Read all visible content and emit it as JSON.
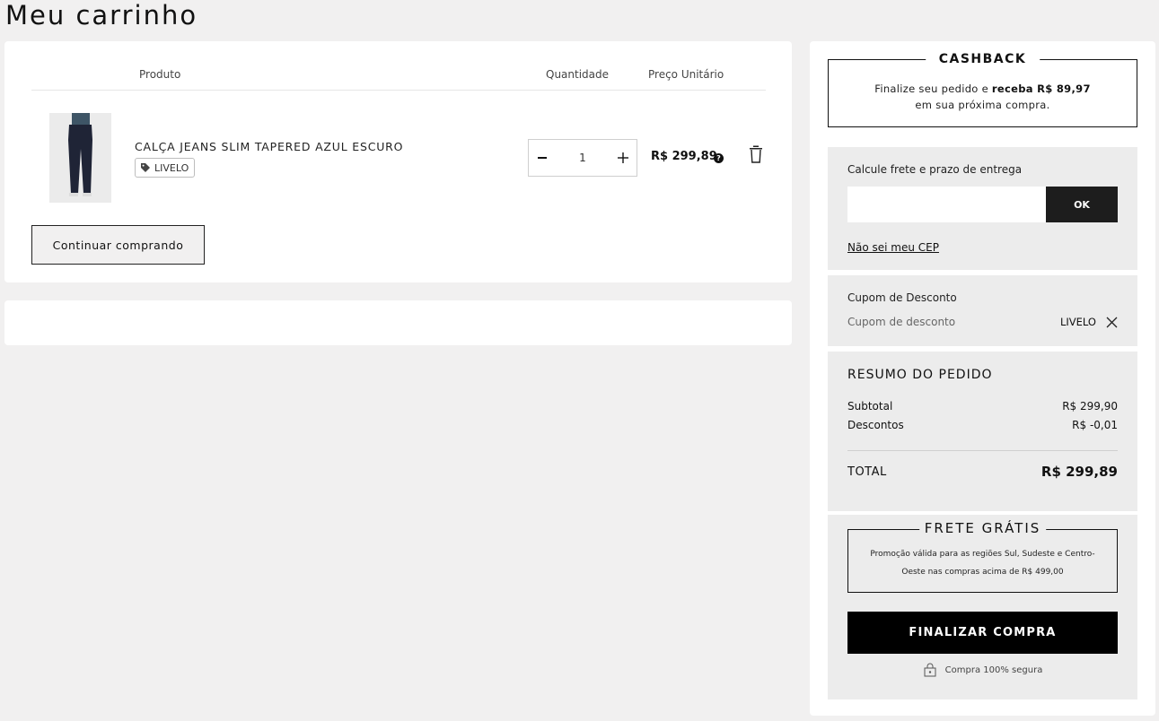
{
  "page": {
    "title": "Meu carrinho"
  },
  "cart": {
    "headers": {
      "product": "Produto",
      "quantity": "Quantidade",
      "unit_price": "Preço Unitário"
    },
    "items": [
      {
        "name": "CALÇA JEANS SLIM TAPERED AZUL ESCURO",
        "tag": "LIVELO",
        "quantity": "1",
        "unit_price": "R$ 299,89"
      }
    ],
    "continue_label": "Continuar comprando"
  },
  "cashback": {
    "title": "CASHBACK",
    "line1_prefix": "Finalize seu pedido e ",
    "line1_bold": "receba R$ 89,97",
    "line2": "em sua próxima compra."
  },
  "shipping": {
    "label": "Calcule frete e prazo de entrega",
    "cep_value": "",
    "ok_label": "OK",
    "cep_link": "Não sei meu CEP"
  },
  "coupon": {
    "label": "Cupom de Desconto",
    "placeholder": "Cupom de desconto",
    "applied_code": "LIVELO"
  },
  "summary": {
    "title": "RESUMO DO PEDIDO",
    "subtotal_label": "Subtotal",
    "subtotal_value": "R$ 299,90",
    "discount_label": "Descontos",
    "discount_value": "R$ -0,01",
    "total_label": "TOTAL",
    "total_value": "R$ 299,89"
  },
  "free_shipping": {
    "title": "FRETE GRÁTIS",
    "text": "Promoção válida para as regiões Sul, Sudeste e Centro-Oeste nas compras acima de R$ 499,00"
  },
  "checkout": {
    "button_label": "FINALIZAR COMPRA",
    "secure_label": "Compra 100% segura"
  },
  "colors": {
    "primary_button": "#000000",
    "panel_gray": "#ececec",
    "page_bg": "#f1f0f0"
  },
  "icons": [
    "minus-icon",
    "plus-icon",
    "help-icon",
    "trash-icon",
    "tag-icon",
    "close-icon",
    "lock-icon"
  ]
}
